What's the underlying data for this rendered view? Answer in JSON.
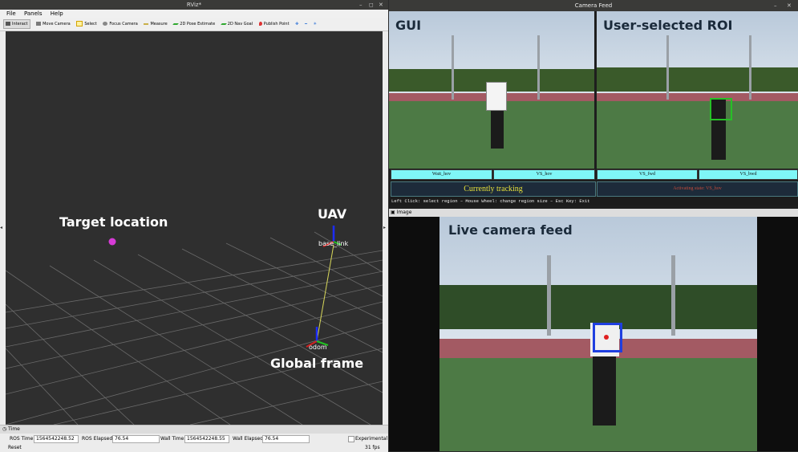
{
  "rviz": {
    "title": "RViz*",
    "window_controls": [
      "–",
      "◻",
      "✕"
    ],
    "menu": [
      "File",
      "Panels",
      "Help"
    ],
    "tools": [
      {
        "label": "Interact",
        "icon": "cursor-icon"
      },
      {
        "label": "Move Camera",
        "icon": "move-camera-icon"
      },
      {
        "label": "Select",
        "icon": "select-icon"
      },
      {
        "label": "Focus Camera",
        "icon": "focus-camera-icon"
      },
      {
        "label": "Measure",
        "icon": "measure-icon"
      },
      {
        "label": "2D Pose Estimate",
        "icon": "pose-estimate-icon"
      },
      {
        "label": "2D Nav Goal",
        "icon": "nav-goal-icon"
      },
      {
        "label": "Publish Point",
        "icon": "publish-point-icon"
      }
    ],
    "viewport": {
      "target_label": "Target location",
      "uav_label": "UAV",
      "base_link_label": "base_link",
      "odom_label": "odom",
      "global_frame_label": "Global frame"
    },
    "time": {
      "header": "Time",
      "ros_time_label": "ROS Time:",
      "ros_time_value": "1564542248.52",
      "ros_elapsed_label": "ROS Elapsed:",
      "ros_elapsed_value": "76.54",
      "wall_time_label": "Wall Time:",
      "wall_time_value": "1564542248.55",
      "wall_elapsed_label": "Wall Elapsed:",
      "wall_elapsed_value": "76.54",
      "experimental_label": "Experimental",
      "reset_label": "Reset",
      "fps": "31 fps"
    }
  },
  "camera_feed": {
    "title": "Camera Feed",
    "close": "✕",
    "minimize": "–",
    "left_pane_title": "GUI",
    "right_pane_title": "User-selected ROI",
    "buttons": [
      "Wait_hov",
      "VS_hov",
      "VS_fwd",
      "VS_bwd"
    ],
    "status_left": "Currently tracking",
    "status_right": "Activating state: VS_hov",
    "instructions": "Left Click: select region  –  Mouse Wheel: change region size  –  Esc Key: Exit",
    "image_window_title": "Image"
  },
  "live_feed": {
    "title": "Live camera feed"
  },
  "colors": {
    "cyan_button": "#7ff6f7",
    "status_text_left": "#e6e03a",
    "status_text_right": "#c04a3a",
    "target_marker": "#d63bd6",
    "roi_box": "#1f3fe0"
  }
}
